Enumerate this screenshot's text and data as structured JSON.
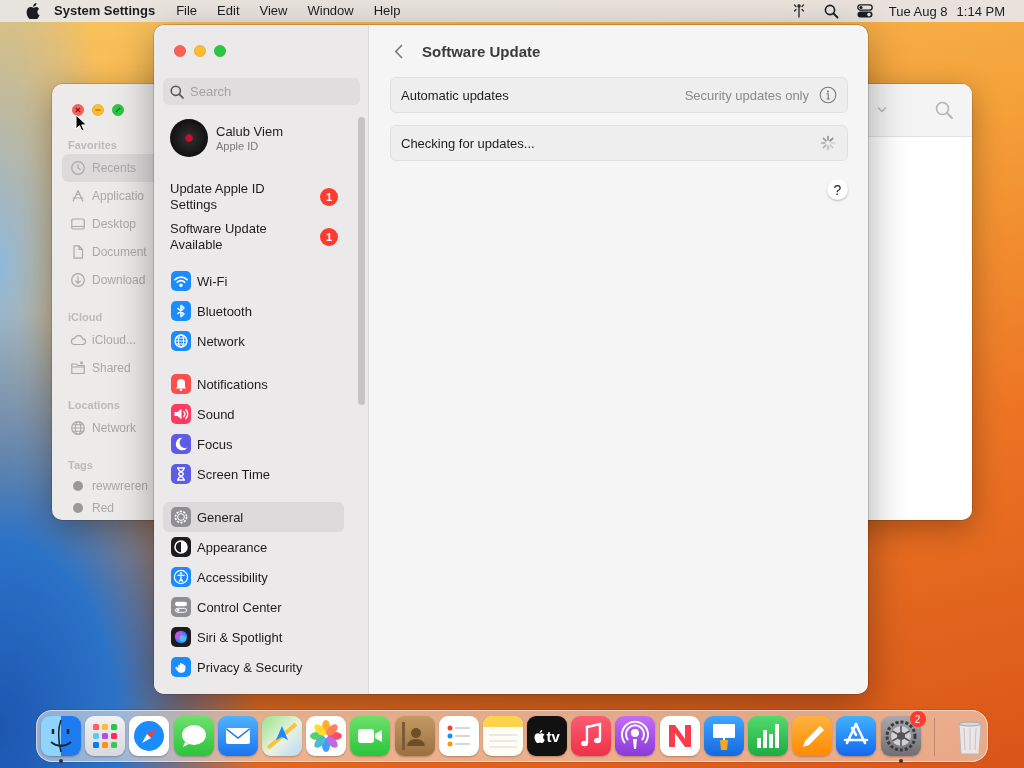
{
  "menu_bar": {
    "app_name": "System Settings",
    "menus": [
      "File",
      "Edit",
      "View",
      "Window",
      "Help"
    ],
    "date": "Tue Aug 8",
    "time": "1:14 PM"
  },
  "finder_window": {
    "sections": [
      {
        "heading": "Favorites",
        "items": [
          {
            "label": "Recents",
            "kind": "clock",
            "selected": true
          },
          {
            "label": "Applicatio",
            "kind": "apps",
            "selected": false
          },
          {
            "label": "Desktop",
            "kind": "desktop",
            "selected": false
          },
          {
            "label": "Document",
            "kind": "document",
            "selected": false
          },
          {
            "label": "Download",
            "kind": "download",
            "selected": false
          }
        ]
      },
      {
        "heading": "iCloud",
        "items": [
          {
            "label": "iCloud...",
            "kind": "cloud",
            "selected": false
          },
          {
            "label": "Shared",
            "kind": "shared",
            "selected": false
          }
        ]
      },
      {
        "heading": "Locations",
        "items": [
          {
            "label": "Network",
            "kind": "globe",
            "selected": false
          }
        ]
      },
      {
        "heading": "Tags",
        "items": [
          {
            "label": "rewwreren",
            "kind": "tag",
            "color": "#9a9898",
            "selected": false
          },
          {
            "label": "Red",
            "kind": "tag",
            "color": "#9a9898",
            "selected": false
          }
        ]
      }
    ]
  },
  "settings_window": {
    "search": {
      "placeholder": "Search"
    },
    "account": {
      "name": "Calub Viem",
      "subtitle": "Apple ID"
    },
    "alerts": [
      {
        "label": "Update Apple ID Settings",
        "badge": "1"
      },
      {
        "label": "Software Update Available",
        "badge": "1"
      }
    ],
    "groups": [
      [
        {
          "label": "Wi-Fi",
          "kind": "wifi",
          "color": "#1a8cff",
          "selected": false
        },
        {
          "label": "Bluetooth",
          "kind": "bluetooth",
          "color": "#1a8cff",
          "selected": false
        },
        {
          "label": "Network",
          "kind": "network",
          "color": "#1a8cff",
          "selected": false
        }
      ],
      [
        {
          "label": "Notifications",
          "kind": "notifications",
          "color": "#ff4d4a",
          "selected": false
        },
        {
          "label": "Sound",
          "kind": "sound",
          "color": "#ff3a5e",
          "selected": false
        },
        {
          "label": "Focus",
          "kind": "focus",
          "color": "#5e5ce6",
          "selected": false
        },
        {
          "label": "Screen Time",
          "kind": "screentime",
          "color": "#5e5ce6",
          "selected": false
        }
      ],
      [
        {
          "label": "General",
          "kind": "general",
          "color": "#8e8e93",
          "selected": true
        },
        {
          "label": "Appearance",
          "kind": "appearance",
          "color": "#1c1c1e",
          "selected": false
        },
        {
          "label": "Accessibility",
          "kind": "accessibility",
          "color": "#1a8cff",
          "selected": false
        },
        {
          "label": "Control Center",
          "kind": "controlcenter",
          "color": "#8e8e93",
          "selected": false
        },
        {
          "label": "Siri & Spotlight",
          "kind": "siri",
          "color": "#1c1c1e",
          "selected": false
        },
        {
          "label": "Privacy & Security",
          "kind": "privacy",
          "color": "#1a8cff",
          "selected": false
        }
      ]
    ],
    "page": {
      "title": "Software Update",
      "rows": [
        {
          "kind": "setting",
          "label": "Automatic updates",
          "value": "Security updates only"
        },
        {
          "kind": "status",
          "label": "Checking for updates..."
        }
      ],
      "help": "?"
    }
  },
  "dock": {
    "apps": [
      {
        "kind": "finder",
        "running": true
      },
      {
        "kind": "launchpad",
        "running": false
      },
      {
        "kind": "safari",
        "running": false
      },
      {
        "kind": "messages",
        "running": false
      },
      {
        "kind": "mail",
        "running": false
      },
      {
        "kind": "maps",
        "running": false
      },
      {
        "kind": "photos",
        "running": false
      },
      {
        "kind": "facetime",
        "running": false
      },
      {
        "kind": "contacts",
        "running": false
      },
      {
        "kind": "reminders",
        "running": false
      },
      {
        "kind": "notes",
        "running": false
      },
      {
        "kind": "tv",
        "label": "tv",
        "running": false
      },
      {
        "kind": "music",
        "running": false
      },
      {
        "kind": "podcasts",
        "running": false
      },
      {
        "kind": "news",
        "running": false
      },
      {
        "kind": "keynote",
        "running": false
      },
      {
        "kind": "numbers",
        "running": false
      },
      {
        "kind": "pages",
        "running": false
      },
      {
        "kind": "appstore",
        "running": false
      },
      {
        "kind": "settings",
        "badge": "2",
        "running": true
      }
    ],
    "trash": {
      "running": false
    }
  }
}
